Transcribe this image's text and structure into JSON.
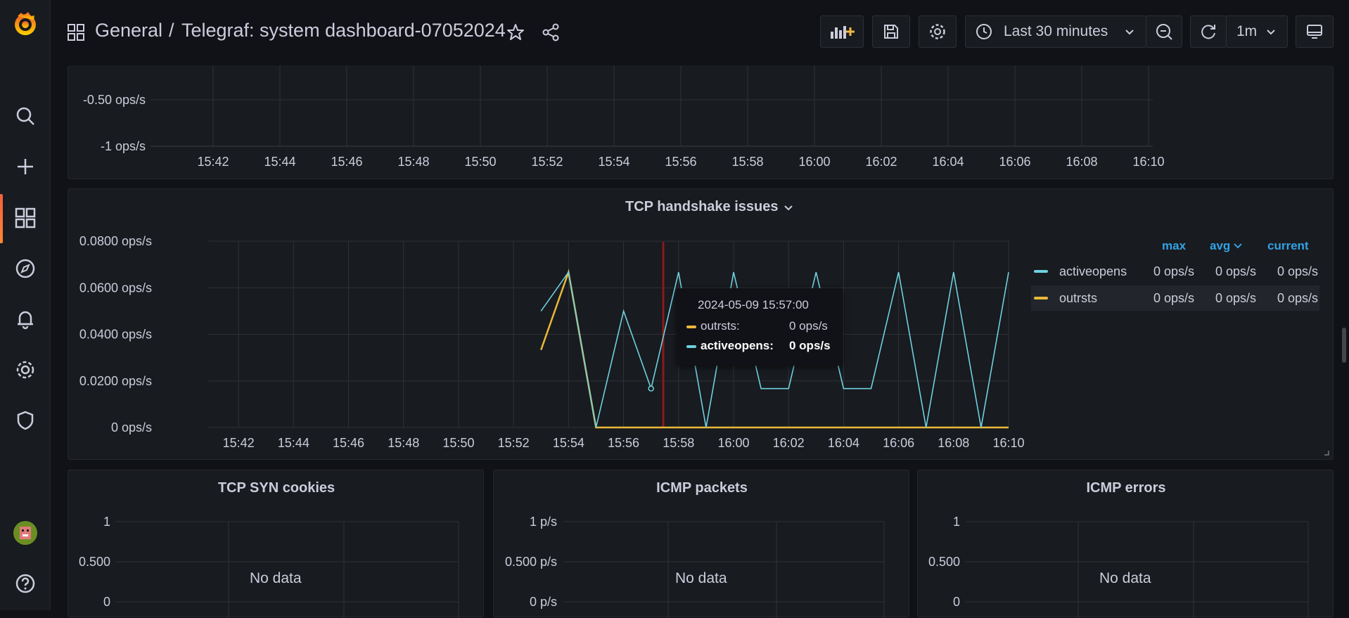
{
  "header": {
    "breadcrumb_folder": "General",
    "breadcrumb_separator": "/",
    "dashboard_title": "Telegraf: system dashboard-07052024",
    "time_range": "Last 30 minutes",
    "refresh_interval": "1m"
  },
  "top_panel": {
    "y_ticks": [
      "-0.50 ops/s",
      "-1 ops/s"
    ],
    "x_ticks": [
      "15:42",
      "15:44",
      "15:46",
      "15:48",
      "15:50",
      "15:52",
      "15:54",
      "15:56",
      "15:58",
      "16:00",
      "16:02",
      "16:04",
      "16:06",
      "16:08",
      "16:10"
    ]
  },
  "tcp_panel": {
    "title": "TCP handshake issues",
    "y_ticks": [
      "0.0800 ops/s",
      "0.0600 ops/s",
      "0.0400 ops/s",
      "0.0200 ops/s",
      "0 ops/s"
    ],
    "x_ticks": [
      "15:42",
      "15:44",
      "15:46",
      "15:48",
      "15:50",
      "15:52",
      "15:54",
      "15:56",
      "15:58",
      "16:00",
      "16:02",
      "16:04",
      "16:06",
      "16:08",
      "16:10"
    ],
    "legend": {
      "headers": {
        "max": "max",
        "avg": "avg",
        "current": "current"
      },
      "rows": [
        {
          "name": "activeopens",
          "color": "#6ed0e0",
          "max": "0 ops/s",
          "avg": "0 ops/s",
          "current": "0 ops/s"
        },
        {
          "name": "outrsts",
          "color": "#eab839",
          "max": "0 ops/s",
          "avg": "0 ops/s",
          "current": "0 ops/s"
        }
      ]
    },
    "tooltip": {
      "time": "2024-05-09 15:57:00",
      "rows": [
        {
          "name": "outrsts:",
          "value": "0 ops/s",
          "color": "#eab839"
        },
        {
          "name": "activeopens:",
          "value": "0 ops/s",
          "color": "#6ed0e0"
        }
      ]
    }
  },
  "chart_data": {
    "type": "line",
    "title": "TCP handshake issues",
    "xlabel": "",
    "ylabel": "",
    "ylim": [
      0,
      0.08
    ],
    "x": [
      "15:53",
      "15:54",
      "15:55",
      "15:56",
      "15:57",
      "15:58",
      "15:59",
      "16:00",
      "16:01",
      "16:02",
      "16:03",
      "16:04",
      "16:05",
      "16:06",
      "16:07",
      "16:08",
      "16:09",
      "16:10"
    ],
    "series": [
      {
        "name": "activeopens",
        "color": "#6ed0e0",
        "values": [
          0.05,
          0.0667,
          0,
          0.05,
          0.0167,
          0.0667,
          0,
          0.0667,
          0.0167,
          0.0167,
          0.0667,
          0.0167,
          0.0167,
          0.0667,
          0,
          0.0667,
          0,
          0.0667
        ]
      },
      {
        "name": "outrsts",
        "color": "#eab839",
        "values": [
          0.0333,
          0.0667,
          0,
          0,
          0,
          0,
          0,
          0,
          0,
          0,
          0,
          0,
          0,
          0,
          0,
          0,
          0,
          0
        ]
      }
    ],
    "grid": true,
    "legend_placement": "right"
  },
  "bottom_panels": [
    {
      "title": "TCP SYN cookies",
      "y_ticks": [
        "1",
        "0.500",
        "0"
      ],
      "message": "No data"
    },
    {
      "title": "ICMP packets",
      "y_ticks": [
        "1 p/s",
        "0.500 p/s",
        "0 p/s"
      ],
      "message": "No data"
    },
    {
      "title": "ICMP errors",
      "y_ticks": [
        "1",
        "0.500",
        "0"
      ],
      "message": "No data"
    }
  ]
}
